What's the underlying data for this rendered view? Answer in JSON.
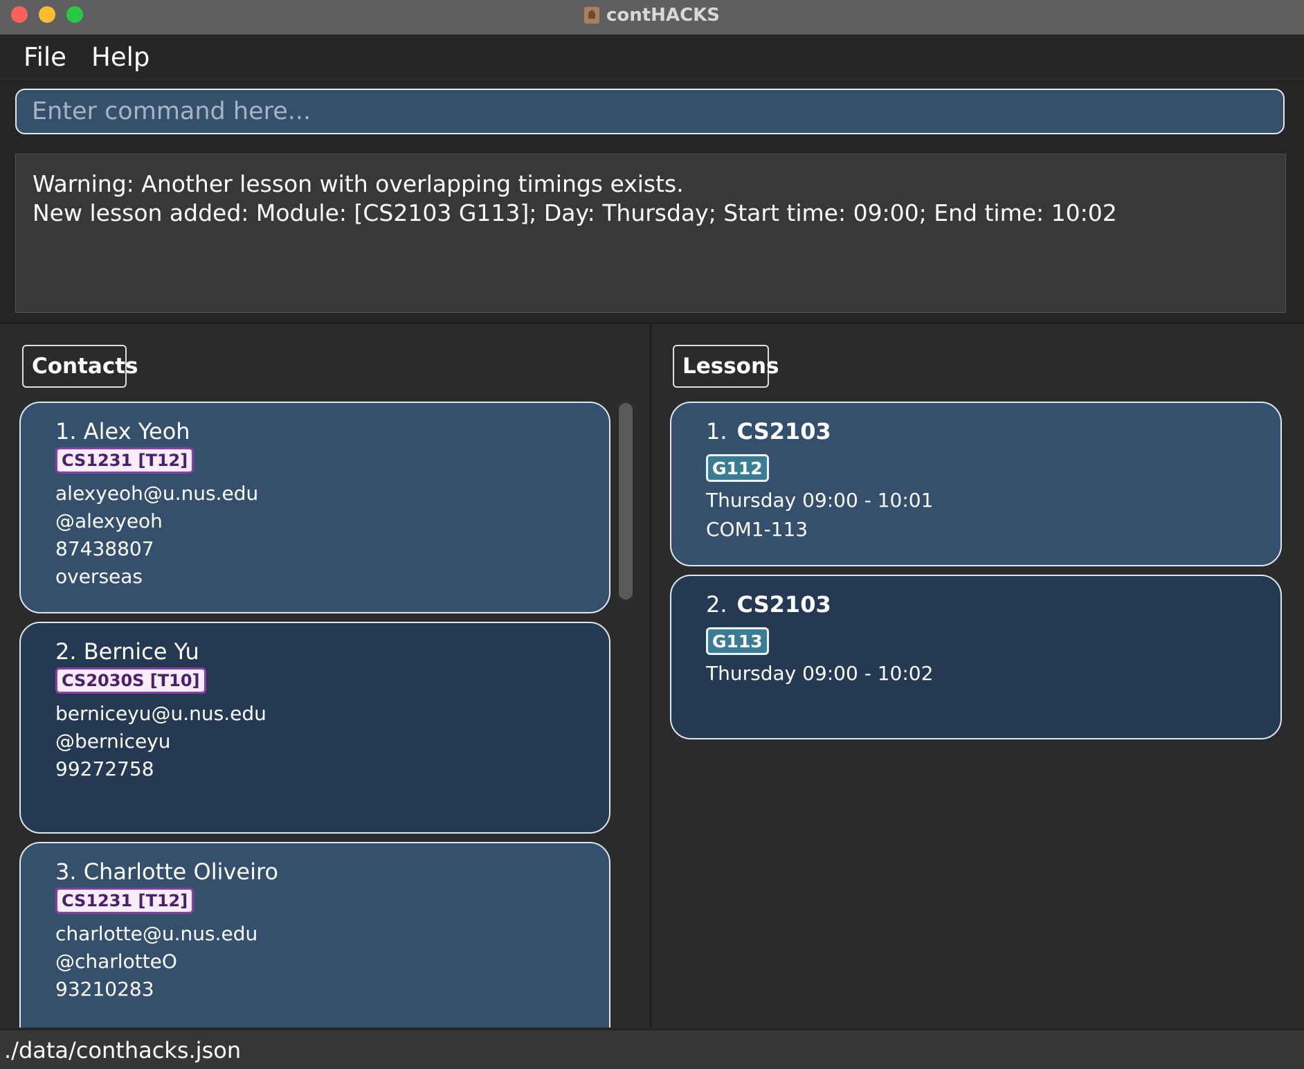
{
  "window": {
    "title": "contHACKS"
  },
  "menu": {
    "file": "File",
    "help": "Help"
  },
  "command": {
    "placeholder": "Enter command here..."
  },
  "result": {
    "line1": "Warning: Another lesson with overlapping timings exists.",
    "line2": "New lesson added: Module: [CS2103 G113]; Day: Thursday; Start time: 09:00; End time: 10:02"
  },
  "contacts": {
    "label": "Contacts",
    "items": [
      {
        "name": "1. Alex Yeoh",
        "tag": "CS1231 [T12]",
        "email": "alexyeoh@u.nus.edu",
        "telegram": "@alexyeoh",
        "phone": "87438807",
        "note": "overseas"
      },
      {
        "name": "2. Bernice Yu",
        "tag": "CS2030S [T10]",
        "email": "berniceyu@u.nus.edu",
        "telegram": "@berniceyu",
        "phone": "99272758"
      },
      {
        "name": "3. Charlotte Oliveiro",
        "tag": "CS1231 [T12]",
        "email": "charlotte@u.nus.edu",
        "telegram": "@charlotteO",
        "phone": "93210283"
      }
    ]
  },
  "lessons": {
    "label": "Lessons",
    "items": [
      {
        "index": "1.",
        "module": "CS2103",
        "group": "G112",
        "time": "Thursday  09:00 - 10:01",
        "venue": "COM1-113"
      },
      {
        "index": "2.",
        "module": "CS2103",
        "group": "G113",
        "time": "Thursday  09:00 - 10:02"
      }
    ]
  },
  "status": {
    "path": "./data/conthacks.json"
  }
}
